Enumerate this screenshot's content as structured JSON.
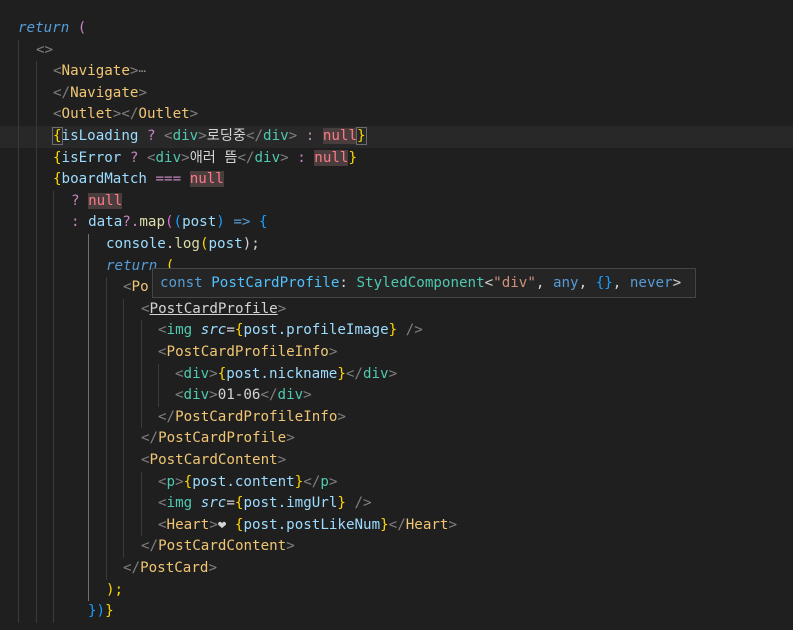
{
  "editor": {
    "lines": [
      [
        "return",
        "(",
        ""
      ],
      [
        "<>"
      ],
      [
        "<",
        "Navigate",
        ">",
        "⋯"
      ],
      [
        "</",
        "Navigate",
        ">"
      ],
      [
        "<",
        "Outlet",
        "></",
        "Outlet",
        ">"
      ],
      [
        "{",
        "isLoading",
        " ? ",
        "<",
        "div",
        ">",
        "로딩중",
        "</",
        "div",
        ">",
        " : ",
        "null",
        "}"
      ],
      [
        "{",
        "isError",
        " ? ",
        "<",
        "div",
        ">",
        "애러 뜸",
        "</",
        "div",
        ">",
        " : ",
        "null",
        "}"
      ],
      [
        "{",
        "boardMatch",
        " === ",
        "null"
      ],
      [
        "? ",
        "null"
      ],
      [
        ": ",
        "data",
        "?.",
        "map",
        "(",
        "(",
        "post",
        ")",
        " => ",
        "{"
      ],
      [
        "console",
        ".",
        "log",
        "(",
        "post",
        ");"
      ],
      [
        "return",
        " ("
      ],
      [
        "<",
        "Po"
      ],
      [
        "<",
        "PostCardProfile",
        ">"
      ],
      [
        "<",
        "img",
        " ",
        "src",
        "=",
        "{",
        "post.profileImage",
        "}",
        " />"
      ],
      [
        "<",
        "PostCardProfileInfo",
        ">"
      ],
      [
        "<",
        "div",
        ">",
        "{",
        "post.nickname",
        "}",
        "</",
        "div",
        ">"
      ],
      [
        "<",
        "div",
        ">",
        "01-06",
        "</",
        "div",
        ">"
      ],
      [
        "</",
        "PostCardProfileInfo",
        ">"
      ],
      [
        "</",
        "PostCardProfile",
        ">"
      ],
      [
        "<",
        "PostCardContent",
        ">"
      ],
      [
        "<",
        "p",
        ">",
        "{",
        "post.content",
        "}",
        "</",
        "p",
        ">"
      ],
      [
        "<",
        "img",
        " ",
        "src",
        "=",
        "{",
        "post.imgUrl",
        "}",
        " />"
      ],
      [
        "<",
        "Heart",
        ">",
        "❤",
        " ",
        "{",
        "post.postLikeNum",
        "}",
        "</",
        "Heart",
        ">"
      ],
      [
        "</",
        "PostCardContent",
        ">"
      ],
      [
        "</",
        "PostCard",
        ">"
      ],
      [
        ");"
      ],
      [
        "})",
        "}"
      ]
    ]
  },
  "tooltip": {
    "parts": [
      "const",
      " ",
      "PostCardProfile",
      ": ",
      "StyledComponent",
      "<",
      "\"div\"",
      ", ",
      "any",
      ", ",
      "{}",
      ", ",
      "never",
      ">"
    ]
  }
}
